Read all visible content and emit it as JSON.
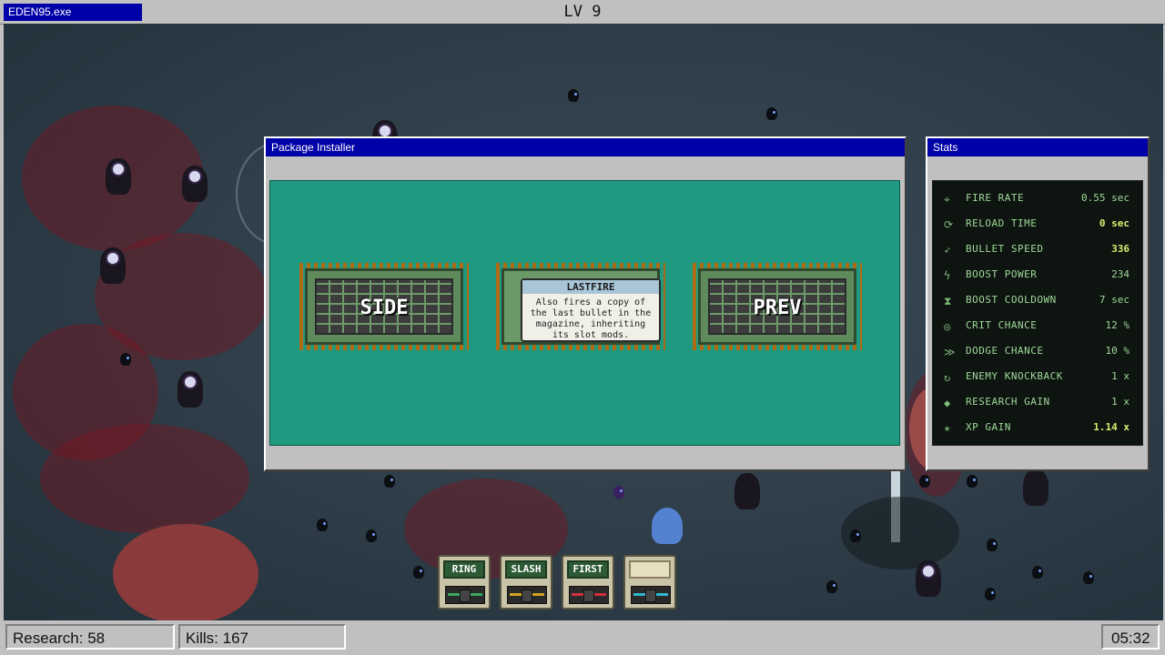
{
  "app": {
    "title": "EDEN95.exe",
    "level": "LV 9"
  },
  "installer": {
    "title": "Package Installer",
    "chips": [
      {
        "label": "SIDE"
      },
      {
        "card_title": "LASTFIRE",
        "card_desc": "Also fires a copy of the last bullet in the magazine, inheriting its slot mods."
      },
      {
        "label": "PREV"
      }
    ]
  },
  "stats": {
    "title": "Stats",
    "rows": [
      {
        "icon": "crosshair-icon",
        "glyph": "⌖",
        "label": "FIRE RATE",
        "value": "0.55 sec"
      },
      {
        "icon": "reload-icon",
        "glyph": "⟳",
        "label": "RELOAD TIME",
        "value": "0 sec"
      },
      {
        "icon": "bullet-icon",
        "glyph": "➶",
        "label": "BULLET SPEED",
        "value": "336"
      },
      {
        "icon": "lightning-icon",
        "glyph": "ϟ",
        "label": "BOOST POWER",
        "value": "234"
      },
      {
        "icon": "hourglass-icon",
        "glyph": "⧗",
        "label": "BOOST COOLDOWN",
        "value": "7 sec"
      },
      {
        "icon": "crit-icon",
        "glyph": "◎",
        "label": "CRIT CHANCE",
        "value": "12 %"
      },
      {
        "icon": "dodge-icon",
        "glyph": "≫",
        "label": "DODGE CHANCE",
        "value": "10 %"
      },
      {
        "icon": "knockback-icon",
        "glyph": "↻",
        "label": "ENEMY KNOCKBACK",
        "value": "1 x"
      },
      {
        "icon": "gem-icon",
        "glyph": "◆",
        "label": "RESEARCH GAIN",
        "value": "1 x"
      },
      {
        "icon": "sparkle-icon",
        "glyph": "✶",
        "label": "XP GAIN",
        "value": "1.14 x"
      }
    ]
  },
  "weapon_slots": [
    {
      "label": "RING",
      "color": "#3aa860"
    },
    {
      "label": "SLASH",
      "color": "#d0a020"
    },
    {
      "label": "FIRST",
      "color": "#d03040"
    },
    {
      "label": "",
      "color": "#30b8d0"
    }
  ],
  "status": {
    "research": "Research: 58",
    "kills": "Kills: 167",
    "timer": "05:32"
  }
}
